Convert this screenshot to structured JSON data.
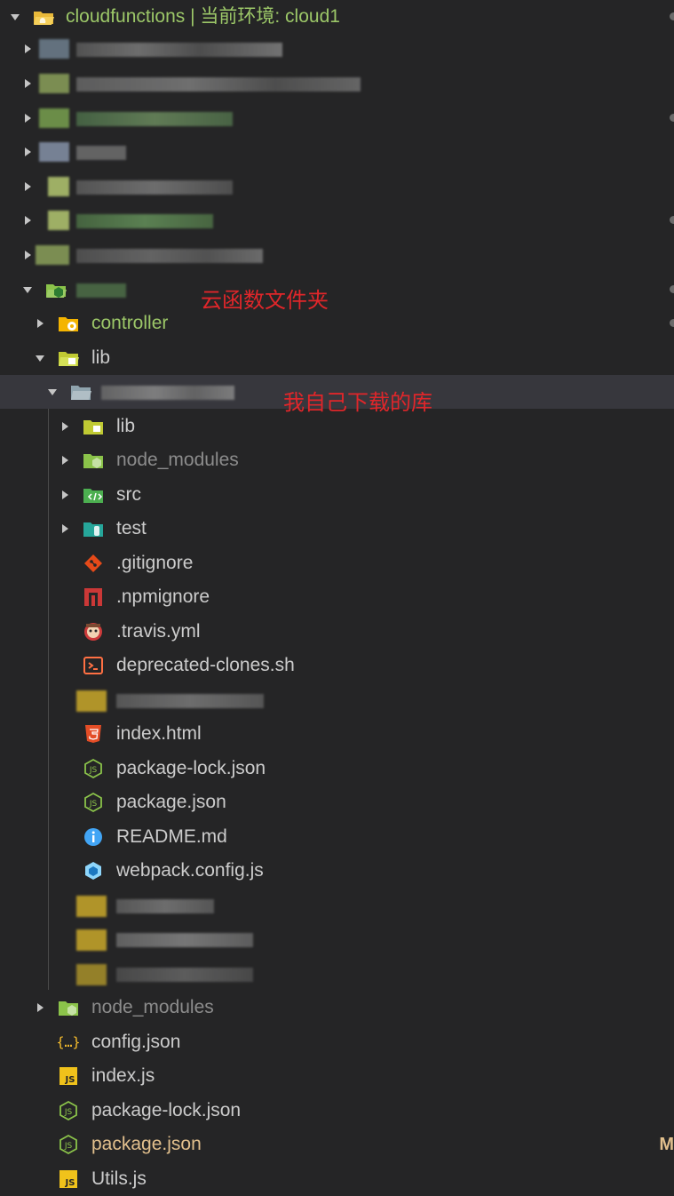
{
  "root": {
    "label": "cloudfunctions | 当前环境: cloud1"
  },
  "annotations": {
    "cloud_function_folder": "云函数文件夹",
    "my_downloaded_library": "我自己下载的库"
  },
  "folder": {
    "controller": "controller",
    "lib": "lib",
    "sub_lib": "lib",
    "sub_node_modules": "node_modules",
    "src": "src",
    "test": "test",
    "node_modules": "node_modules"
  },
  "files": {
    "gitignore": ".gitignore",
    "npmignore": ".npmignore",
    "travis": ".travis.yml",
    "deprecated": "deprecated-clones.sh",
    "index_html": "index.html",
    "pkg_lock_inner": "package-lock.json",
    "pkg_inner": "package.json",
    "readme": "README.md",
    "webpack": "webpack.config.js",
    "config_json": "config.json",
    "index_js": "index.js",
    "pkg_lock": "package-lock.json",
    "pkg": "package.json",
    "utils": "Utils.js"
  },
  "git_status": {
    "package_json": "M"
  },
  "colors": {
    "background": "#252526",
    "selected_row": "#37373d",
    "text": "#cccccc",
    "green_text": "#9cc768",
    "modified_text": "#e2c08d",
    "annotation_red": "#e0262a"
  }
}
